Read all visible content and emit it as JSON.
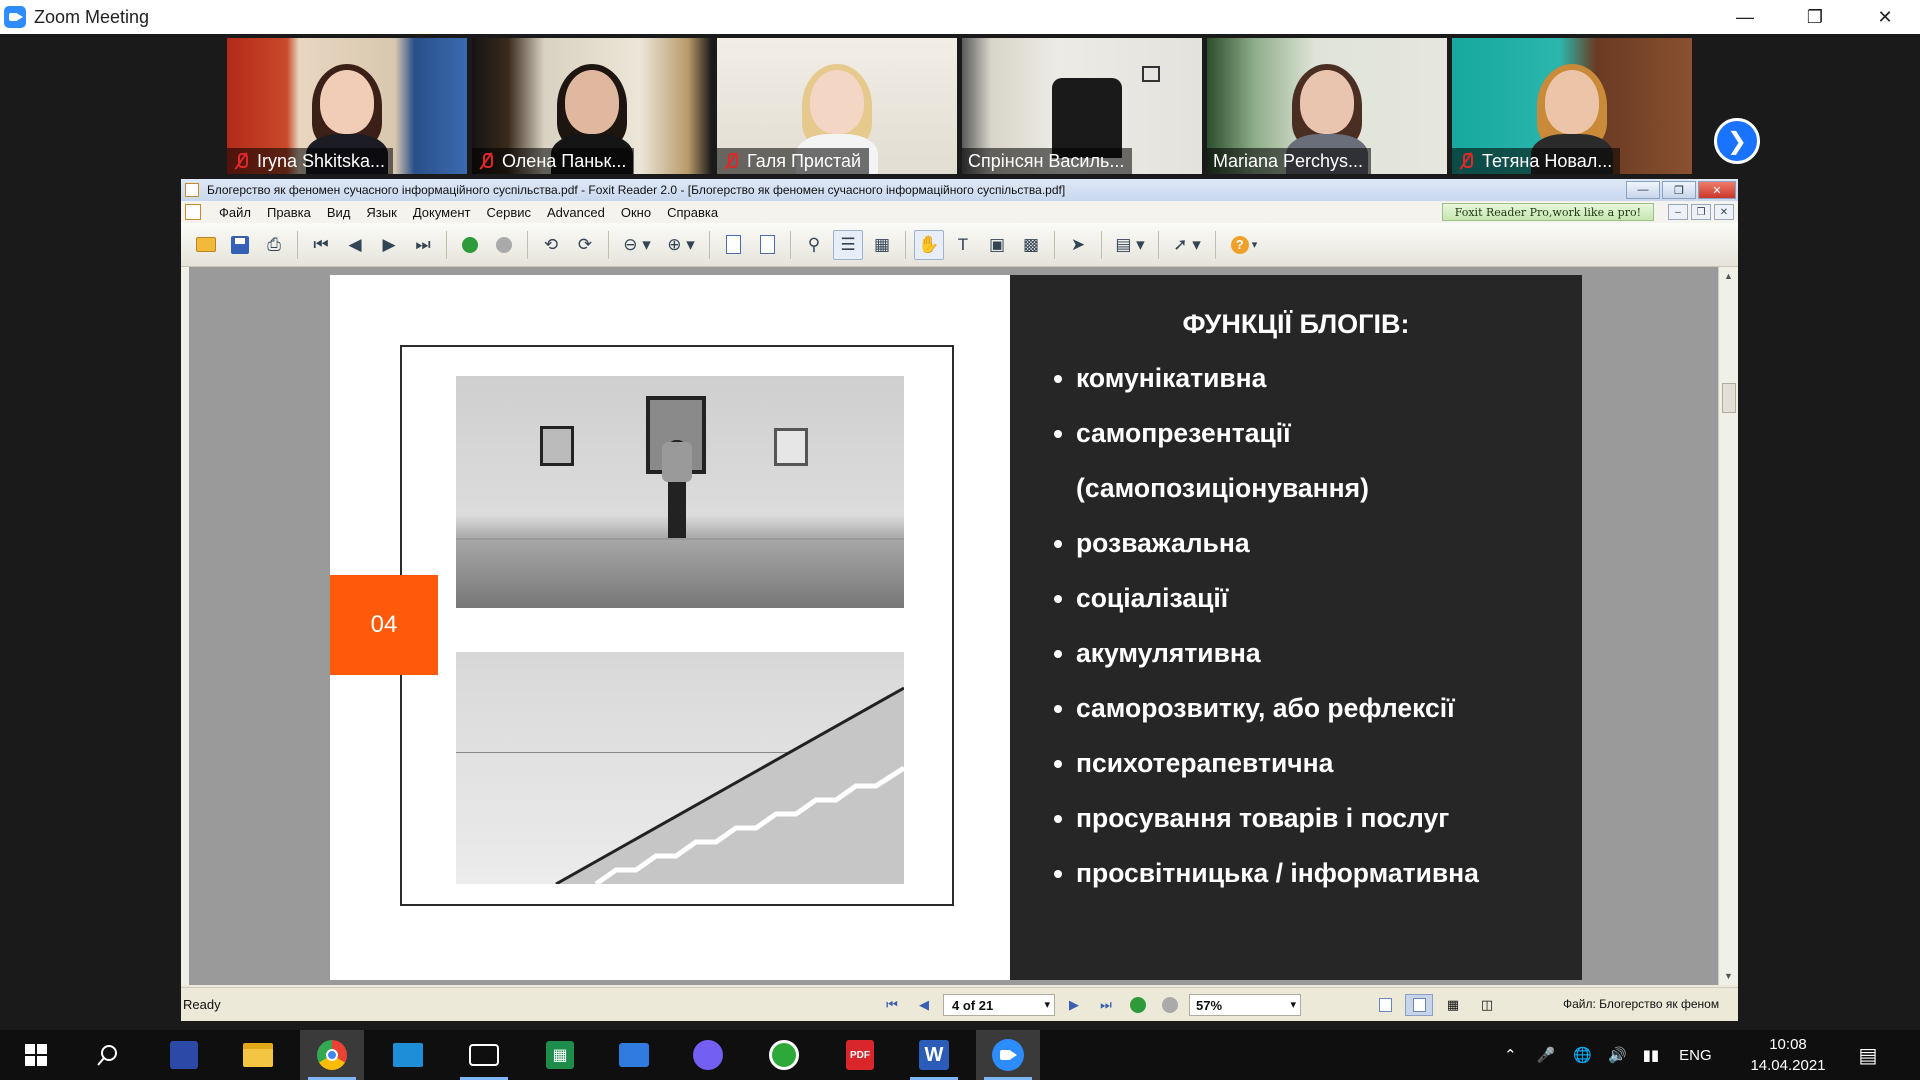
{
  "zoom": {
    "window_title": "Zoom Meeting",
    "participants": [
      {
        "name": "Iryna Shkitska...",
        "muted": true,
        "active": false
      },
      {
        "name": "Олена Паньк...",
        "muted": true,
        "active": false
      },
      {
        "name": "Галя Пристай",
        "muted": true,
        "active": false
      },
      {
        "name": "Спрінсян Василь...",
        "muted": false,
        "active": false
      },
      {
        "name": "Mariana Perchys...",
        "muted": false,
        "active": true
      },
      {
        "name": "Тетяна Новал...",
        "muted": true,
        "active": false
      }
    ]
  },
  "foxit": {
    "title": "Блогерство як феномен сучасного інформаційного суспільства.pdf - Foxit Reader 2.0 - [Блогерство як феномен сучасного інформаційного суспільства.pdf]",
    "menu": [
      "Файл",
      "Правка",
      "Вид",
      "Язык",
      "Документ",
      "Сервис",
      "Advanced",
      "Окно",
      "Справка"
    ],
    "promo": "Foxit Reader Pro,work like a pro!",
    "status": {
      "ready": "Ready",
      "page": "4 of 21",
      "zoom": "57%",
      "file": "Файл: Блогерство як феном"
    }
  },
  "slide": {
    "badge": "04",
    "heading": "ФУНКЦІЇ БЛОГІВ:",
    "bullets": [
      "комунікативна",
      "самопрезентації",
      "(самопозиціонування)",
      "розважальна",
      "соціалізації",
      "акумулятивна",
      "саморозвитку, або рефлексії",
      "психотерапевтична",
      "просування товарів і послуг",
      "просвітницька / інформативна"
    ]
  },
  "taskbar": {
    "language": "ENG",
    "time": "10:08",
    "date": "14.04.2021"
  }
}
